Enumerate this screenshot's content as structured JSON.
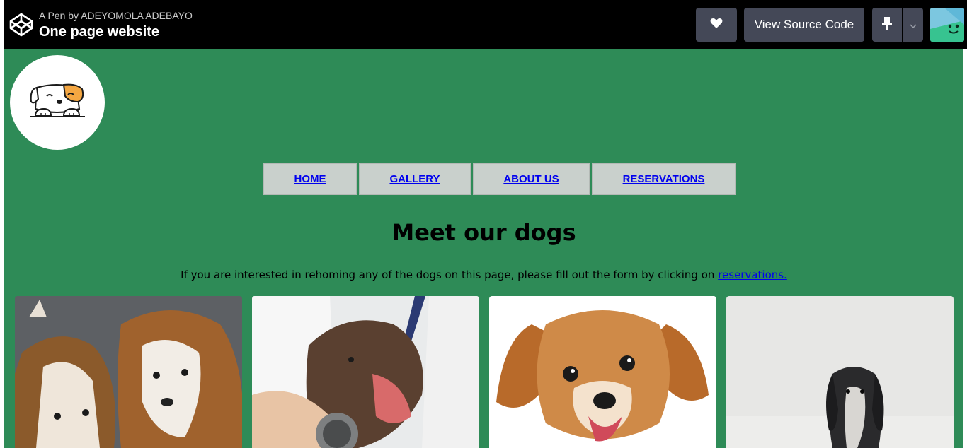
{
  "header": {
    "pen_by": "A Pen by ADEYOMOLA ADEBAYO",
    "title": "One page website",
    "view_source_label": "View Source Code",
    "icons": [
      "codepen-logo-icon",
      "heart-icon",
      "pin-icon",
      "chevron-down-icon",
      "avatar"
    ]
  },
  "nav": {
    "items": [
      {
        "label": "HOME"
      },
      {
        "label": "GALLERY"
      },
      {
        "label": "ABOUT US"
      },
      {
        "label": "RESERVATIONS"
      }
    ]
  },
  "main": {
    "heading": "Meet our dogs",
    "intro_text": "If you are interested in rehoming any of the dogs on this page, please fill out the form by clicking on ",
    "intro_link": "reservations."
  },
  "colors": {
    "header_bg": "#000000",
    "button_bg": "#444857",
    "page_bg": "#2e8b57",
    "nav_bg": "#c9d0cc",
    "link": "#0000ee"
  }
}
